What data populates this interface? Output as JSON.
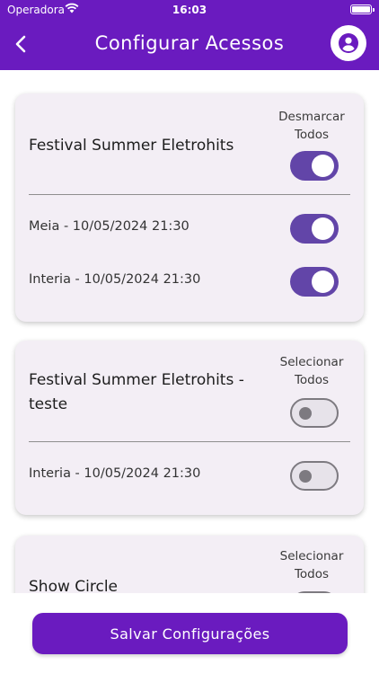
{
  "status_bar": {
    "carrier": "Operadora",
    "time": "16:03"
  },
  "header": {
    "title": "Configurar Acessos"
  },
  "events": [
    {
      "title": "Festival Summer Eletrohits",
      "toggle_all_label_line1": "Desmarcar",
      "toggle_all_label_line2": "Todos",
      "toggle_all_state": "on",
      "sessions": [
        {
          "label": "Meia - 10/05/2024 21:30",
          "state": "on"
        },
        {
          "label": "Interia - 10/05/2024 21:30",
          "state": "on"
        }
      ]
    },
    {
      "title_line1": "Festival Summer Eletrohits -",
      "title_line2": "teste",
      "toggle_all_label_line1": "Selecionar",
      "toggle_all_label_line2": "Todos",
      "toggle_all_state": "off",
      "sessions": [
        {
          "label": "Interia - 10/05/2024 21:30",
          "state": "off"
        }
      ]
    },
    {
      "title": "Show Circle",
      "toggle_all_label_line1": "Selecionar",
      "toggle_all_label_line2": "Todos",
      "toggle_all_state": "off",
      "sessions": []
    }
  ],
  "footer": {
    "save_label": "Salvar Configurações"
  },
  "colors": {
    "brand": "#6a1bbf",
    "toggle_on": "#6245a8",
    "card_bg": "#f3eef5"
  }
}
